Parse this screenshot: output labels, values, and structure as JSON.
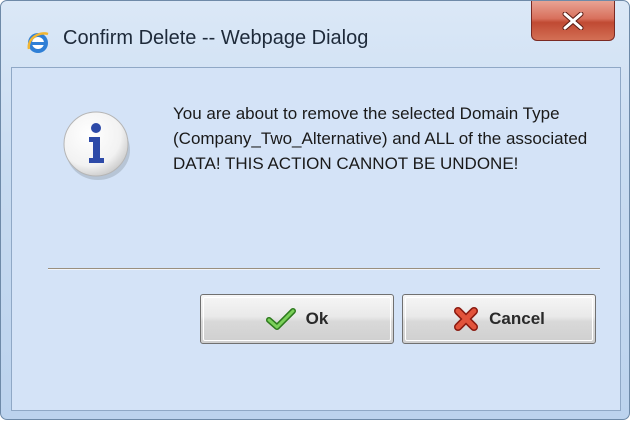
{
  "window": {
    "title": "Confirm Delete -- Webpage Dialog",
    "app_icon": "ie-icon",
    "close_icon": "close-icon"
  },
  "dialog": {
    "icon": "info-icon",
    "message": "You are about to remove the selected Domain Type (Company_Two_Alternative) and ALL of the associated DATA! THIS ACTION CANNOT BE UNDONE!"
  },
  "buttons": {
    "ok_label": "Ok",
    "ok_icon": "checkmark-icon",
    "cancel_label": "Cancel",
    "cancel_icon": "red-x-icon"
  },
  "colors": {
    "frame": "#c9dcf1",
    "client": "#d4e3f7",
    "close_button": "#c04a33"
  }
}
